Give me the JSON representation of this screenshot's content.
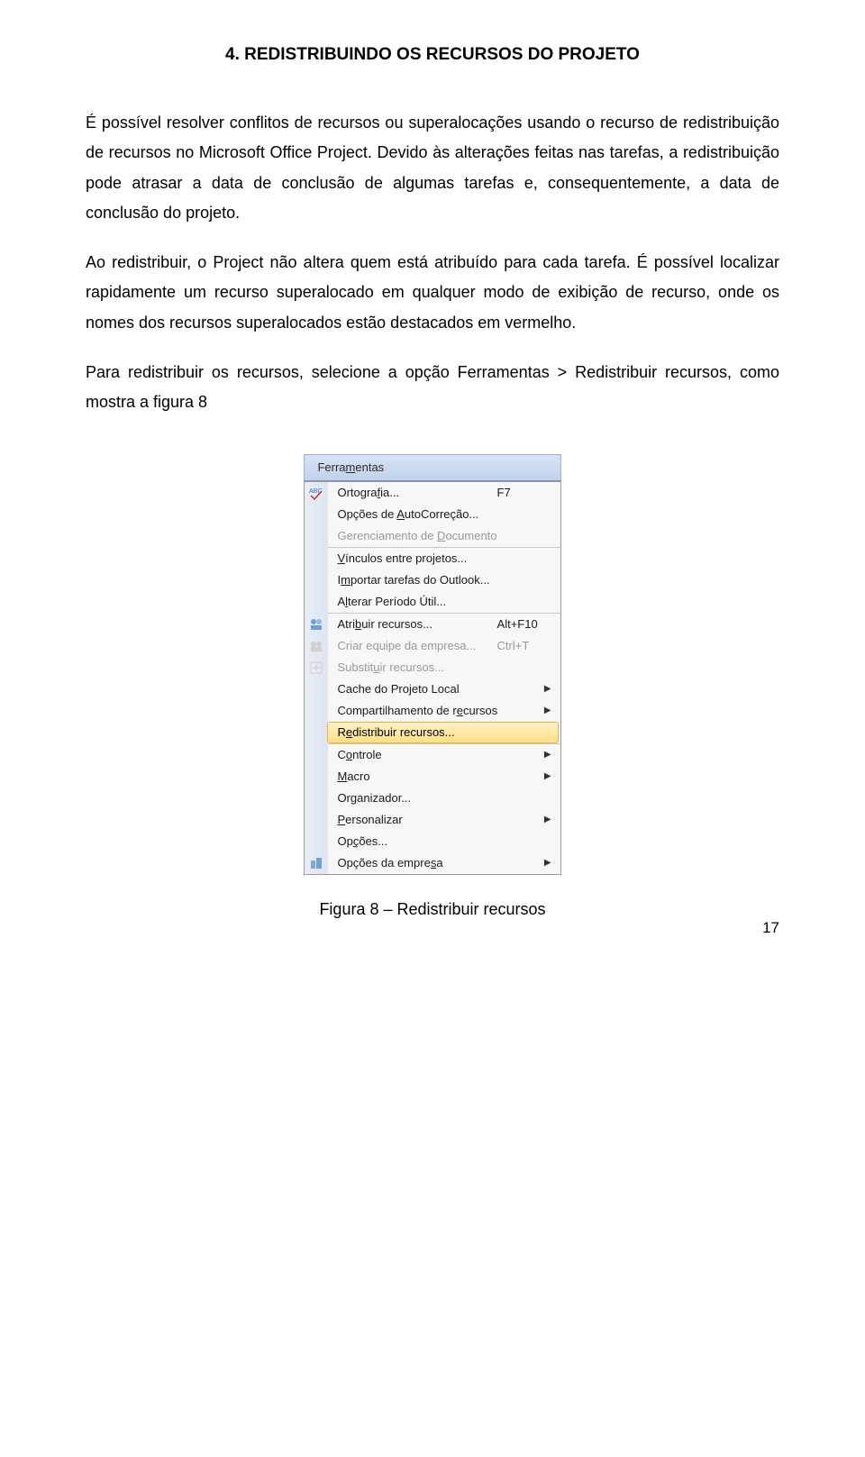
{
  "heading": "4. REDISTRIBUINDO OS RECURSOS DO PROJETO",
  "paragraphs": {
    "p1": "É possível resolver conflitos de recursos ou superalocações usando o recurso de redistribuição de recursos no Microsoft Office Project. Devido às alterações feitas nas tarefas, a redistribuição pode atrasar a data de conclusão de algumas tarefas e, consequentemente, a data de conclusão do projeto.",
    "p2": "Ao redistribuir, o Project não altera quem está atribuído para cada tarefa. É possível localizar rapidamente um recurso superalocado em qualquer modo de exibição de recurso, onde os nomes dos recursos superalocados estão destacados em vermelho.",
    "p3": "Para redistribuir os recursos, selecione a opção Ferramentas > Redistribuir recursos, como mostra a figura 8"
  },
  "figure_caption": "Figura 8 – Redistribuir recursos",
  "page_number": "17",
  "menu": {
    "title_html": "Ferra<span class='mn'>m</span>entas",
    "items": [
      {
        "type": "item",
        "icon": "abc",
        "label_html": "Ortogra<span class='mn'>f</span>ia...",
        "shortcut": "F7",
        "disabled": false,
        "sub": false
      },
      {
        "type": "item",
        "icon": "",
        "label_html": "Opções de <span class='mn'>A</span>utoCorreção...",
        "shortcut": "",
        "disabled": false,
        "sub": false
      },
      {
        "type": "item",
        "icon": "",
        "label_html": "Gerenciamento de <span class='mn'>D</span>ocumento",
        "shortcut": "",
        "disabled": true,
        "sub": false
      },
      {
        "type": "sep"
      },
      {
        "type": "item",
        "icon": "",
        "label_html": "<span class='mn'>V</span>ínculos entre projetos...",
        "shortcut": "",
        "disabled": false,
        "sub": false
      },
      {
        "type": "item",
        "icon": "",
        "label_html": "I<span class='mn'>m</span>portar tarefas do Outlook...",
        "shortcut": "",
        "disabled": false,
        "sub": false
      },
      {
        "type": "item",
        "icon": "",
        "label_html": "A<span class='mn'>l</span>terar Período Útil...",
        "shortcut": "",
        "disabled": false,
        "sub": false
      },
      {
        "type": "sep"
      },
      {
        "type": "item",
        "icon": "res",
        "label_html": "Atri<span class='mn'>b</span>uir recursos...",
        "shortcut": "Alt+F10",
        "disabled": false,
        "sub": false
      },
      {
        "type": "item",
        "icon": "team",
        "label_html": "Criar equipe da empresa...",
        "shortcut": "Ctrl+T",
        "disabled": true,
        "sub": false
      },
      {
        "type": "item",
        "icon": "subst",
        "label_html": "Substit<span class='mn'>u</span>ir recursos...",
        "shortcut": "",
        "disabled": true,
        "sub": false
      },
      {
        "type": "item",
        "icon": "",
        "label_html": "Cache do Projeto Local",
        "shortcut": "",
        "disabled": false,
        "sub": true
      },
      {
        "type": "item",
        "icon": "",
        "label_html": "Compartilhamento de r<span class='mn'>e</span>cursos",
        "shortcut": "",
        "disabled": false,
        "sub": true
      },
      {
        "type": "item",
        "icon": "",
        "label_html": "R<span class='mn'>e</span>distribuir recursos...",
        "shortcut": "",
        "disabled": false,
        "sub": false,
        "highlight": true
      },
      {
        "type": "sep"
      },
      {
        "type": "item",
        "icon": "",
        "label_html": "C<span class='mn'>o</span>ntrole",
        "shortcut": "",
        "disabled": false,
        "sub": true
      },
      {
        "type": "item",
        "icon": "",
        "label_html": "<span class='mn'>M</span>acro",
        "shortcut": "",
        "disabled": false,
        "sub": true
      },
      {
        "type": "item",
        "icon": "",
        "label_html": "Or<span class='mn'>g</span>anizador...",
        "shortcut": "",
        "disabled": false,
        "sub": false
      },
      {
        "type": "item",
        "icon": "",
        "label_html": "<span class='mn'>P</span>ersonalizar",
        "shortcut": "",
        "disabled": false,
        "sub": true
      },
      {
        "type": "item",
        "icon": "",
        "label_html": "Op<span class='mn'>ç</span>ões...",
        "shortcut": "",
        "disabled": false,
        "sub": false
      },
      {
        "type": "item",
        "icon": "ent",
        "label_html": "Opções da empre<span class='mn'>s</span>a",
        "shortcut": "",
        "disabled": false,
        "sub": true
      }
    ]
  }
}
